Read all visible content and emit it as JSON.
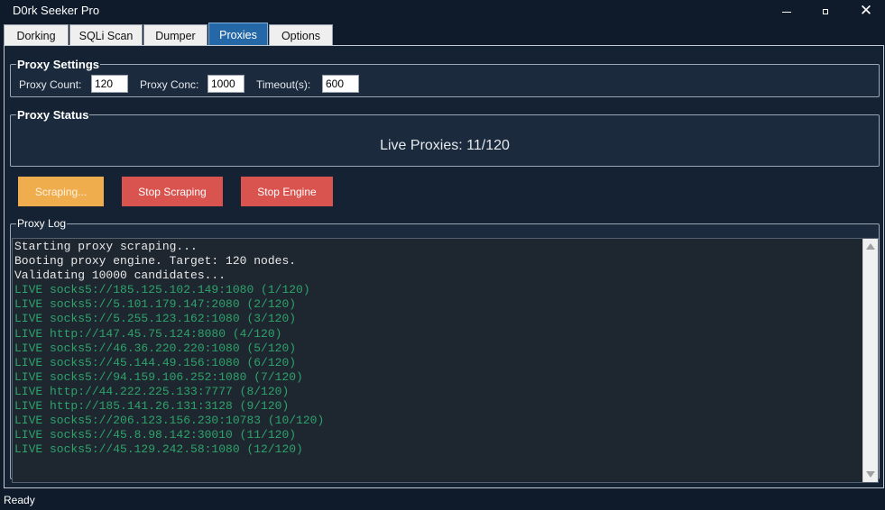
{
  "window": {
    "title": "D0rk Seeker Pro"
  },
  "tabs": [
    {
      "label": "Dorking",
      "active": false
    },
    {
      "label": "SQLi Scan",
      "active": false
    },
    {
      "label": "Dumper",
      "active": false
    },
    {
      "label": "Proxies",
      "active": true
    },
    {
      "label": "Options",
      "active": false
    }
  ],
  "proxy_settings": {
    "title": "Proxy Settings",
    "count_label": "Proxy Count:",
    "count_value": "120",
    "conc_label": "Proxy Conc:",
    "conc_value": "1000",
    "timeout_label": "Timeout(s):",
    "timeout_value": "600"
  },
  "proxy_status": {
    "title": "Proxy Status",
    "live_text": "Live Proxies: 11/120"
  },
  "buttons": {
    "scraping": "Scraping...",
    "stop_scraping": "Stop Scraping",
    "stop_engine": "Stop Engine"
  },
  "proxy_log": {
    "title": "Proxy Log",
    "lines": [
      {
        "text": "Starting proxy scraping...",
        "kind": "info"
      },
      {
        "text": "Booting proxy engine. Target: 120 nodes.",
        "kind": "info"
      },
      {
        "text": "Validating 10000 candidates...",
        "kind": "info"
      },
      {
        "text": "LIVE socks5://185.125.102.149:1080 (1/120)",
        "kind": "live"
      },
      {
        "text": "LIVE socks5://5.101.179.147:2080 (2/120)",
        "kind": "live"
      },
      {
        "text": "LIVE socks5://5.255.123.162:1080 (3/120)",
        "kind": "live"
      },
      {
        "text": "LIVE http://147.45.75.124:8080 (4/120)",
        "kind": "live"
      },
      {
        "text": "LIVE socks5://46.36.220.220:1080 (5/120)",
        "kind": "live"
      },
      {
        "text": "LIVE socks5://45.144.49.156:1080 (6/120)",
        "kind": "live"
      },
      {
        "text": "LIVE socks5://94.159.106.252:1080 (7/120)",
        "kind": "live"
      },
      {
        "text": "LIVE http://44.222.225.133:7777 (8/120)",
        "kind": "live"
      },
      {
        "text": "LIVE http://185.141.26.131:3128 (9/120)",
        "kind": "live"
      },
      {
        "text": "LIVE socks5://206.123.156.230:10783 (10/120)",
        "kind": "live"
      },
      {
        "text": "LIVE socks5://45.8.98.142:30010 (11/120)",
        "kind": "live"
      },
      {
        "text": "LIVE socks5://45.129.242.58:1080 (12/120)",
        "kind": "live"
      }
    ]
  },
  "statusbar": {
    "text": "Ready"
  },
  "colors": {
    "background": "#0f1b2b",
    "active_tab": "#2568a8",
    "scraping_button": "#f0ad4e",
    "stop_button": "#d9534f",
    "live_text": "#2ea36a"
  },
  "icons": [
    "minimize-icon",
    "maximize-icon",
    "close-icon",
    "scroll-up-icon",
    "scroll-down-icon"
  ]
}
